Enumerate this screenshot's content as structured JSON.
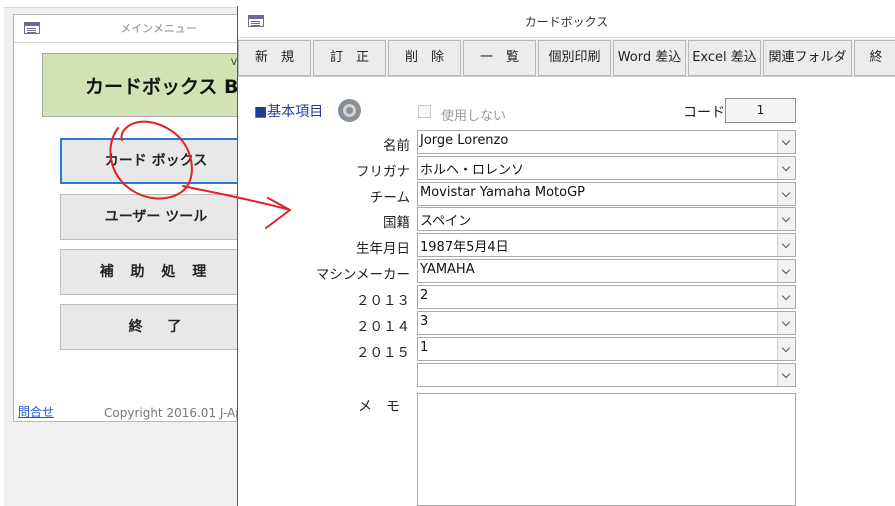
{
  "menu_window": {
    "title": "メインメニュー",
    "banner_version": "V",
    "banner_title": "カードボックス BA",
    "buttons": [
      "カード ボックス",
      "ユーザー ツール",
      "補 助 処 理",
      "終　 了"
    ],
    "contact_link": "問合せ",
    "copyright": "Copyright 2016.01 J-Ap"
  },
  "card_window": {
    "title": "カードボックス",
    "toolbar": [
      "新　規",
      "訂　正",
      "削　除",
      "一　覧",
      "個別印刷",
      "Word 差込",
      "Excel 差込",
      "関連フォルダ",
      "終"
    ],
    "section_label": "■基本項目",
    "unused_label": "使用しない",
    "code_label": "コード",
    "code_value": "1",
    "fields": [
      {
        "label": "名前",
        "value": "Jorge Lorenzo"
      },
      {
        "label": "フリガナ",
        "value": "ホルヘ・ロレンソ"
      },
      {
        "label": "チーム",
        "value": "Movistar Yamaha MotoGP"
      },
      {
        "label": "国籍",
        "value": "スペイン"
      },
      {
        "label": "生年月日",
        "value": "1987年5月4日"
      },
      {
        "label": "マシンメーカー",
        "value": "YAMAHA"
      },
      {
        "label": "２０１３",
        "value": "2"
      },
      {
        "label": "２０１４",
        "value": "3"
      },
      {
        "label": "２０１５",
        "value": "1"
      },
      {
        "label": "",
        "value": ""
      }
    ],
    "memo_label": "メモ"
  },
  "annotation": {
    "color": "#e0202a"
  }
}
